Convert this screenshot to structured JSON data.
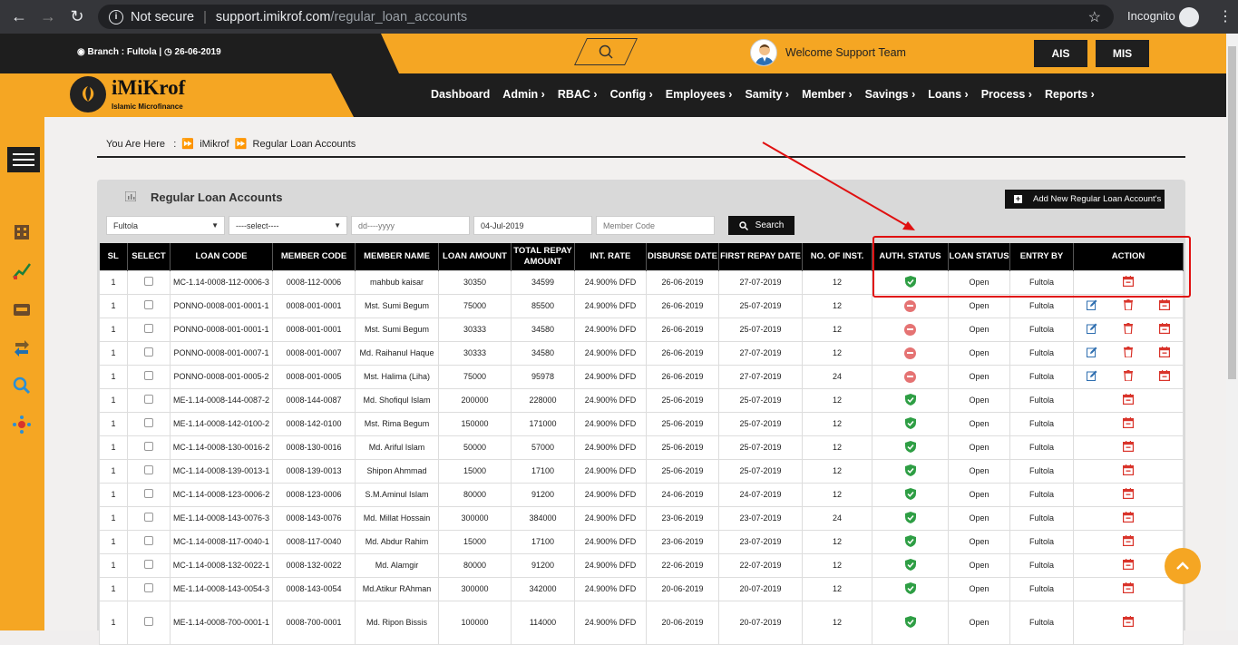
{
  "browser": {
    "not_secure": "Not secure",
    "url_domain": "support.imikrof.com",
    "url_path": "/regular_loan_accounts",
    "incognito": "Incognito"
  },
  "header": {
    "branch": "Branch : Fultola |",
    "date": "26-06-2019",
    "welcome": "Welcome Support Team",
    "ais": "AIS",
    "mis": "MIS",
    "logo_name": "iMiKrof",
    "logo_sub": "Islamic Microfinance"
  },
  "menu": [
    "Dashboard",
    "Admin ›",
    "RBAC ›",
    "Config ›",
    "Employees ›",
    "Samity ›",
    "Member ›",
    "Savings ›",
    "Loans ›",
    "Process ›",
    "Reports ›"
  ],
  "breadcrumb": {
    "prefix": "You Are Here",
    "home": "iMikrof",
    "current": "Regular Loan Accounts"
  },
  "panel": {
    "title": "Regular Loan Accounts",
    "add_button": "Add New Regular Loan Account's"
  },
  "filters": {
    "branch": "Fultola",
    "select": "----select----",
    "date_from": "dd----yyyy",
    "date_to": "04-Jul-2019",
    "member_code": "Member Code",
    "search": "Search"
  },
  "table": {
    "headers": [
      "SL",
      "SELECT",
      "LOAN CODE",
      "MEMBER CODE",
      "MEMBER NAME",
      "LOAN AMOUNT",
      "TOTAL REPAY AMOUNT",
      "INT. RATE",
      "DISBURSE DATE",
      "FIRST REPAY DATE",
      "NO. OF INST.",
      "AUTH. STATUS",
      "LOAN STATUS",
      "ENTRY BY",
      "ACTION"
    ],
    "rows": [
      [
        "1",
        "MC-1.14-0008-112-0006-3",
        "0008-112-0006",
        "mahbub kaisar",
        "30350",
        "34599",
        "24.900% DFD",
        "26-06-2019",
        "27-07-2019",
        "12",
        "ok",
        "Open",
        "Fultola",
        "single"
      ],
      [
        "1",
        "PONNO-0008-001-0001-1",
        "0008-001-0001",
        "Mst. Sumi Begum",
        "75000",
        "85500",
        "24.900% DFD",
        "26-06-2019",
        "25-07-2019",
        "12",
        "no",
        "Open",
        "Fultola",
        "full"
      ],
      [
        "1",
        "PONNO-0008-001-0001-1",
        "0008-001-0001",
        "Mst. Sumi Begum",
        "30333",
        "34580",
        "24.900% DFD",
        "26-06-2019",
        "25-07-2019",
        "12",
        "no",
        "Open",
        "Fultola",
        "full"
      ],
      [
        "1",
        "PONNO-0008-001-0007-1",
        "0008-001-0007",
        "Md. Raihanul Haque",
        "30333",
        "34580",
        "24.900% DFD",
        "26-06-2019",
        "27-07-2019",
        "12",
        "no",
        "Open",
        "Fultola",
        "full"
      ],
      [
        "1",
        "PONNO-0008-001-0005-2",
        "0008-001-0005",
        "Mst. Halima (Liha)",
        "75000",
        "95978",
        "24.900% DFD",
        "26-06-2019",
        "27-07-2019",
        "24",
        "no",
        "Open",
        "Fultola",
        "full"
      ],
      [
        "1",
        "ME-1.14-0008-144-0087-2",
        "0008-144-0087",
        "Md. Shofiqul Islam",
        "200000",
        "228000",
        "24.900% DFD",
        "25-06-2019",
        "25-07-2019",
        "12",
        "ok",
        "Open",
        "Fultola",
        "single"
      ],
      [
        "1",
        "ME-1.14-0008-142-0100-2",
        "0008-142-0100",
        "Mst. Rima Begum",
        "150000",
        "171000",
        "24.900% DFD",
        "25-06-2019",
        "25-07-2019",
        "12",
        "ok",
        "Open",
        "Fultola",
        "single"
      ],
      [
        "1",
        "MC-1.14-0008-130-0016-2",
        "0008-130-0016",
        "Md. Ariful Islam",
        "50000",
        "57000",
        "24.900% DFD",
        "25-06-2019",
        "25-07-2019",
        "12",
        "ok",
        "Open",
        "Fultola",
        "single"
      ],
      [
        "1",
        "MC-1.14-0008-139-0013-1",
        "0008-139-0013",
        "Shipon Ahmmad",
        "15000",
        "17100",
        "24.900% DFD",
        "25-06-2019",
        "25-07-2019",
        "12",
        "ok",
        "Open",
        "Fultola",
        "single"
      ],
      [
        "1",
        "MC-1.14-0008-123-0006-2",
        "0008-123-0006",
        "S.M.Aminul Islam",
        "80000",
        "91200",
        "24.900% DFD",
        "24-06-2019",
        "24-07-2019",
        "12",
        "ok",
        "Open",
        "Fultola",
        "single"
      ],
      [
        "1",
        "ME-1.14-0008-143-0076-3",
        "0008-143-0076",
        "Md. Millat Hossain",
        "300000",
        "384000",
        "24.900% DFD",
        "23-06-2019",
        "23-07-2019",
        "24",
        "ok",
        "Open",
        "Fultola",
        "single"
      ],
      [
        "1",
        "MC-1.14-0008-117-0040-1",
        "0008-117-0040",
        "Md. Abdur Rahim",
        "15000",
        "17100",
        "24.900% DFD",
        "23-06-2019",
        "23-07-2019",
        "12",
        "ok",
        "Open",
        "Fultola",
        "single"
      ],
      [
        "1",
        "MC-1.14-0008-132-0022-1",
        "0008-132-0022",
        "Md. Alamgir",
        "80000",
        "91200",
        "24.900% DFD",
        "22-06-2019",
        "22-07-2019",
        "12",
        "ok",
        "Open",
        "Fultola",
        "single"
      ],
      [
        "1",
        "ME-1.14-0008-143-0054-3",
        "0008-143-0054",
        "Md.Atikur RAhman",
        "300000",
        "342000",
        "24.900% DFD",
        "20-06-2019",
        "20-07-2019",
        "12",
        "ok",
        "Open",
        "Fultola",
        "single"
      ],
      [
        "1",
        "ME-1.14-0008-700-0001-1",
        "0008-700-0001",
        "Md. Ripon Bissis",
        "100000",
        "114000",
        "24.900% DFD",
        "20-06-2019",
        "20-07-2019",
        "12",
        "ok",
        "Open",
        "Fultola",
        "single"
      ]
    ]
  },
  "colors": {
    "accent": "#f5a623",
    "dark": "#1e1e1e",
    "highlight": "#e01010",
    "ok": "#2e9e44"
  }
}
